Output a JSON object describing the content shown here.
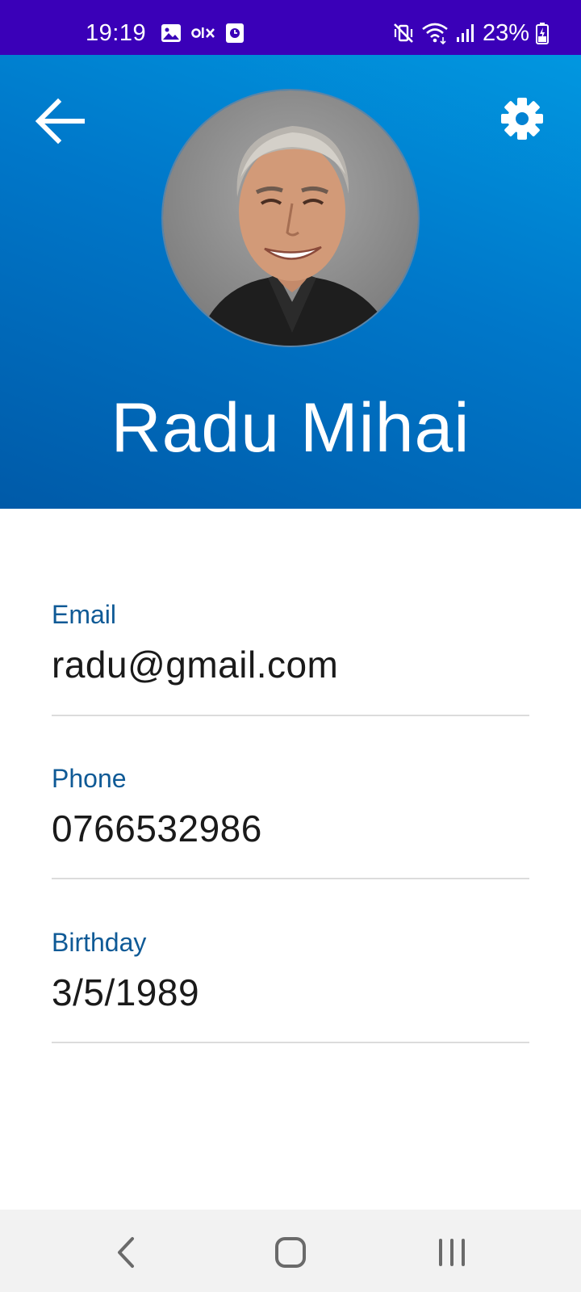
{
  "status_bar": {
    "time": "19:19",
    "battery": "23%",
    "left_icons": [
      "gallery-icon",
      "olx-icon",
      "clock-app-icon"
    ],
    "right_icons": [
      "mute-vibrate-icon",
      "wifi-icon",
      "signal-icon",
      "battery-charging-icon"
    ]
  },
  "header": {
    "back_icon": "arrow-left-icon",
    "settings_icon": "gear-icon",
    "name": "Radu Mihai",
    "colors": {
      "gradient_start": "#0197e0",
      "gradient_end": "#005aa8"
    }
  },
  "fields": [
    {
      "label": "Email",
      "value": "radu@gmail.com"
    },
    {
      "label": "Phone",
      "value": "0766532986"
    },
    {
      "label": "Birthday",
      "value": "3/5/1989"
    }
  ],
  "colors": {
    "status_bar": "#3a00b8",
    "label": "#0f5a96",
    "value": "#1a1a1a",
    "divider": "#dcdcdc"
  },
  "nav_bar": {
    "icons": [
      "back-nav-icon",
      "home-nav-icon",
      "recents-nav-icon"
    ]
  }
}
